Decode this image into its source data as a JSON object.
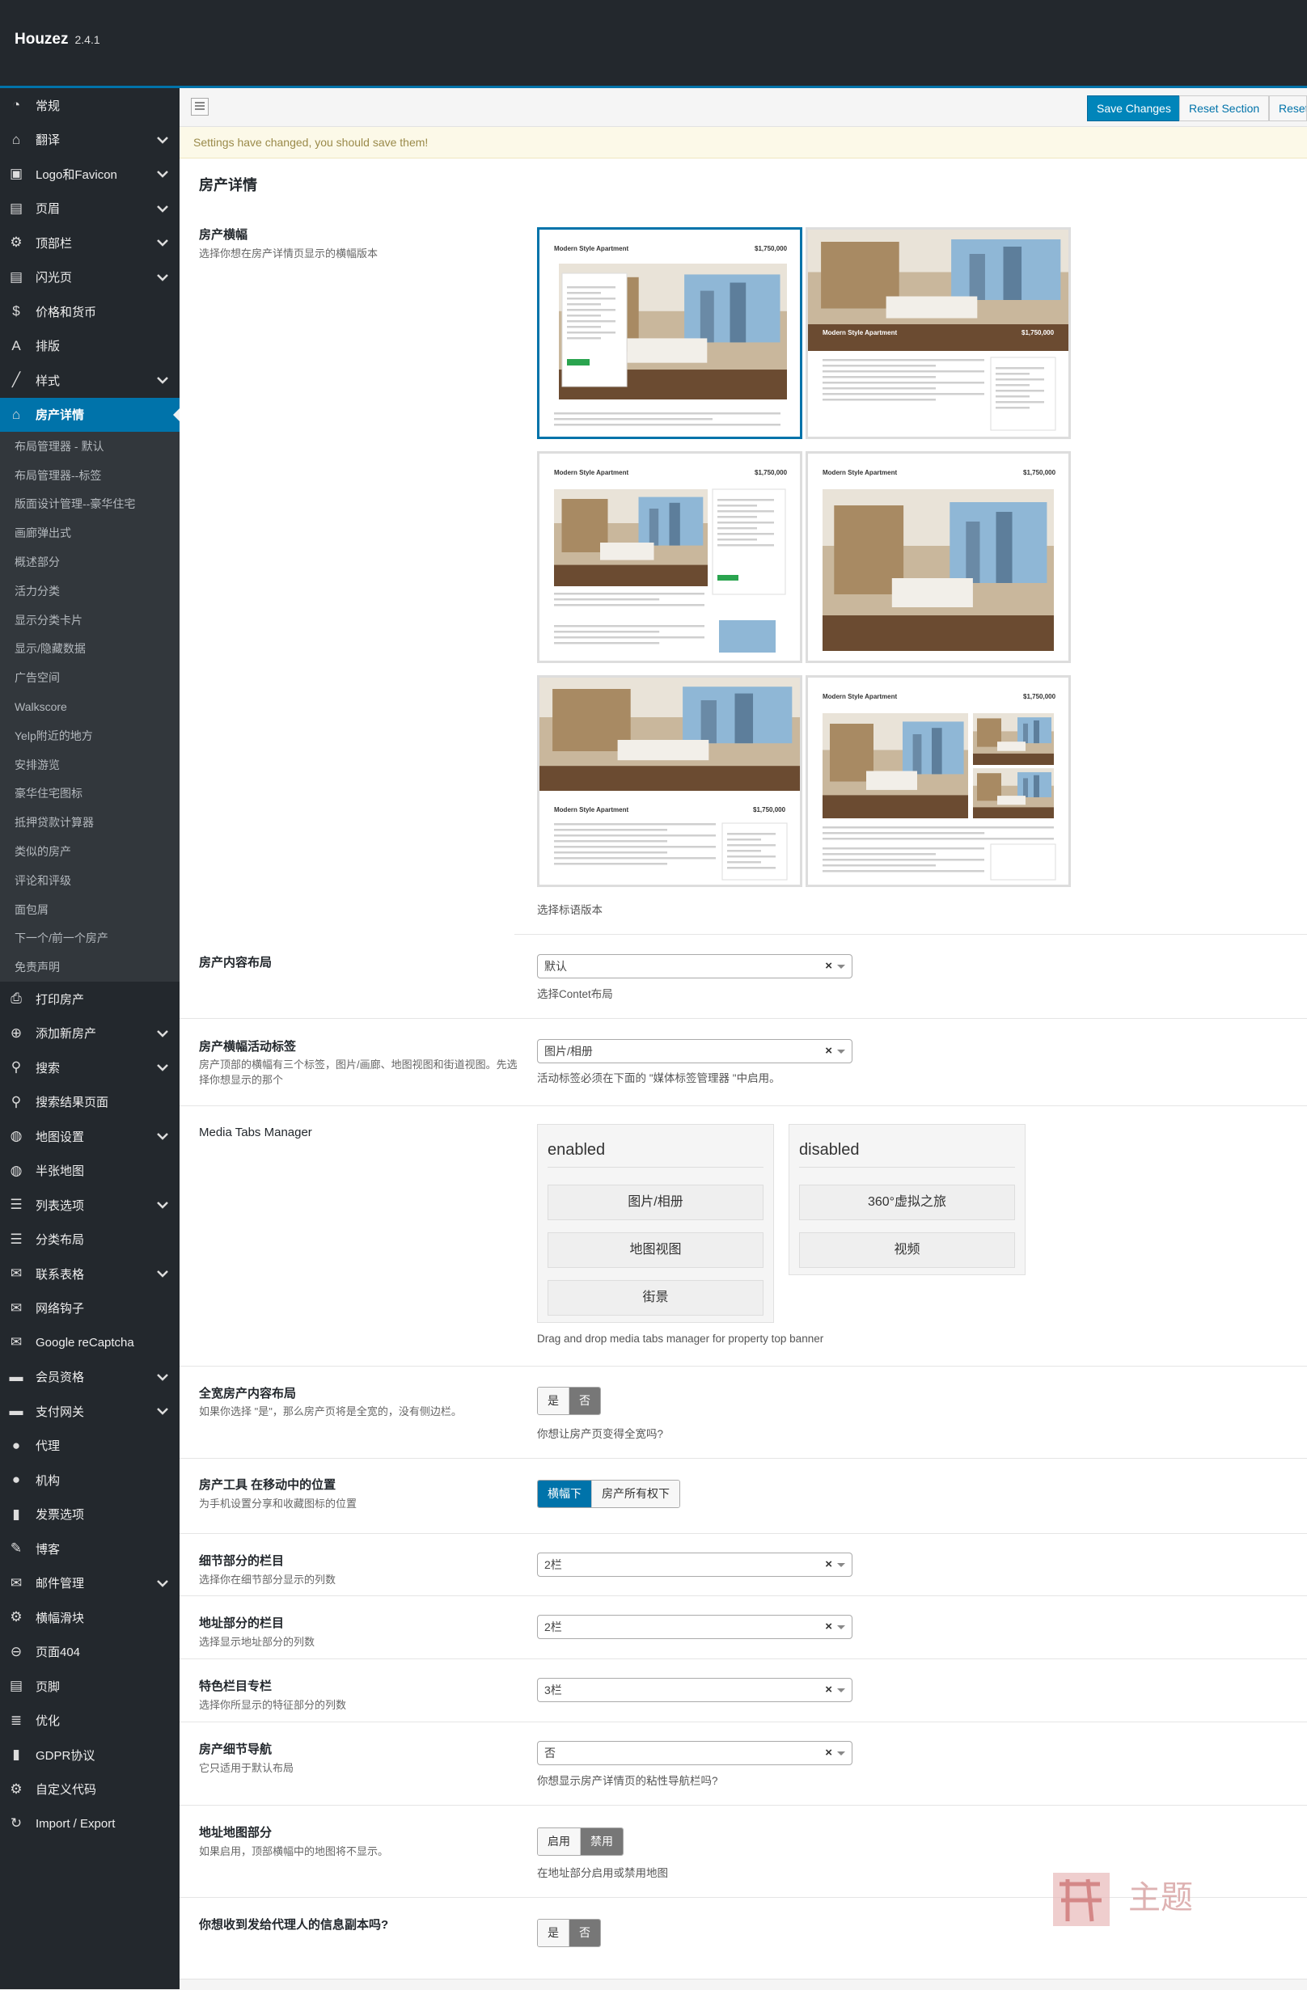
{
  "app": {
    "name": "Houzez",
    "version": "2.4.1"
  },
  "sidebar": {
    "items_top": [
      {
        "label": "常规",
        "icon": "gauge-icon",
        "arrow": false
      },
      {
        "label": "翻译",
        "icon": "home-icon",
        "arrow": true
      },
      {
        "label": "Logo和Favicon",
        "icon": "image-icon",
        "arrow": true
      },
      {
        "label": "页眉",
        "icon": "layout-icon",
        "arrow": true
      },
      {
        "label": "顶部栏",
        "icon": "gear-icon",
        "arrow": true
      },
      {
        "label": "闪光页",
        "icon": "layout-icon",
        "arrow": true
      },
      {
        "label": "价格和货币",
        "icon": "dollar-icon",
        "arrow": false
      },
      {
        "label": "排版",
        "icon": "font-icon",
        "arrow": false
      },
      {
        "label": "样式",
        "icon": "brush-icon",
        "arrow": true
      },
      {
        "label": "房产详情",
        "icon": "home-icon",
        "arrow": false,
        "active": true
      }
    ],
    "sub_items": [
      "布局管理器 - 默认",
      "布局管理器--标签",
      "版面设计管理--豪华住宅",
      "画廊弹出式",
      "概述部分",
      "活力分类",
      "显示分类卡片",
      "显示/隐藏数据",
      "广告空间",
      "Walkscore",
      "Yelp附近的地方",
      "安排游览",
      "豪华住宅图标",
      "抵押贷款计算器",
      "类似的房产",
      "评论和评级",
      "面包屑",
      "下一个/前一个房产",
      "免责声明"
    ],
    "items_bottom": [
      {
        "label": "打印房产",
        "icon": "print-icon",
        "arrow": false
      },
      {
        "label": "添加新房产",
        "icon": "plus-circle-icon",
        "arrow": true
      },
      {
        "label": "搜索",
        "icon": "search-icon",
        "arrow": true
      },
      {
        "label": "搜索结果页面",
        "icon": "search-icon",
        "arrow": false
      },
      {
        "label": "地图设置",
        "icon": "globe-icon",
        "arrow": true
      },
      {
        "label": "半张地图",
        "icon": "globe-icon",
        "arrow": false
      },
      {
        "label": "列表选项",
        "icon": "list-icon",
        "arrow": true
      },
      {
        "label": "分类布局",
        "icon": "list-icon",
        "arrow": false
      },
      {
        "label": "联系表格",
        "icon": "envelope-icon",
        "arrow": true
      },
      {
        "label": "网络钩子",
        "icon": "envelope-icon",
        "arrow": false
      },
      {
        "label": "Google reCaptcha",
        "icon": "envelope-icon",
        "arrow": false
      },
      {
        "label": "会员资格",
        "icon": "card-icon",
        "arrow": true
      },
      {
        "label": "支付网关",
        "icon": "card-icon",
        "arrow": true
      },
      {
        "label": "代理",
        "icon": "user-icon",
        "arrow": false
      },
      {
        "label": "机构",
        "icon": "user-icon",
        "arrow": false
      },
      {
        "label": "发票选项",
        "icon": "building-icon",
        "arrow": false
      },
      {
        "label": "博客",
        "icon": "edit-icon",
        "arrow": false
      },
      {
        "label": "邮件管理",
        "icon": "envelope-icon",
        "arrow": true
      },
      {
        "label": "横幅滑块",
        "icon": "gear-icon",
        "arrow": false
      },
      {
        "label": "页面404",
        "icon": "minus-circle-icon",
        "arrow": false
      },
      {
        "label": "页脚",
        "icon": "layout-icon",
        "arrow": false
      },
      {
        "label": "优化",
        "icon": "optimize-icon",
        "arrow": false
      },
      {
        "label": "GDPR协议",
        "icon": "bookmark-icon",
        "arrow": false
      },
      {
        "label": "自定义代码",
        "icon": "gear-icon",
        "arrow": false
      },
      {
        "label": "Import / Export",
        "icon": "refresh-icon",
        "arrow": false
      }
    ]
  },
  "toolbar": {
    "save": "Save Changes",
    "reset_section": "Reset Section",
    "reset": "Reset"
  },
  "notice": "Settings have changed, you should save them!",
  "section_title": "房产详情",
  "banner": {
    "title": "房产横幅",
    "desc": "选择你想在房产详情页显示的横幅版本",
    "note": "选择标语版本",
    "thumb_title": "Modern Style Apartment",
    "thumb_price": "$1,750,000",
    "selected_index": 0
  },
  "content_layout": {
    "title": "房产内容布局",
    "value": "默认",
    "note": "选择Contet布局"
  },
  "active_tab": {
    "title": "房产横幅活动标签",
    "desc": "房产顶部的横幅有三个标签，图片/画廊、地图视图和街道视图。先选择你想显示的那个",
    "value": "图片/相册",
    "note": "活动标签必须在下面的 \"媒体标签管理器 \"中启用。"
  },
  "media_tabs": {
    "title": "Media Tabs Manager",
    "enabled_label": "enabled",
    "disabled_label": "disabled",
    "enabled": [
      "图片/相册",
      "地图视图",
      "街景"
    ],
    "disabled": [
      "360°虚拟之旅",
      "视频"
    ],
    "note": "Drag and drop media tabs manager for property top banner"
  },
  "fullwidth": {
    "title": "全宽房产内容布局",
    "desc": "如果你选择 \"是\"，那么房产页将是全宽的，没有侧边栏。",
    "yes": "是",
    "no": "否",
    "note": "你想让房产页变得全宽吗?"
  },
  "tools_pos": {
    "title": "房产工具 在移动中的位置",
    "desc": "为手机设置分享和收藏图标的位置",
    "opt1": "横幅下",
    "opt2": "房产所有权下"
  },
  "detail_cols": {
    "title": "细节部分的栏目",
    "desc": "选择你在细节部分显示的列数",
    "value": "2栏"
  },
  "address_cols": {
    "title": "地址部分的栏目",
    "desc": "选择显示地址部分的列数",
    "value": "2栏"
  },
  "feature_cols": {
    "title": "特色栏目专栏",
    "desc": "选择你所显示的特征部分的列数",
    "value": "3栏"
  },
  "detail_nav": {
    "title": "房产细节导航",
    "desc": "它只适用于默认布局",
    "value": "否",
    "note": "你想显示房产详情页的粘性导航栏吗?"
  },
  "map_section": {
    "title": "地址地图部分",
    "desc": "如果启用，顶部横幅中的地图将不显示。",
    "on": "启用",
    "off": "禁用",
    "note": "在地址部分启用或禁用地图"
  },
  "agent_copy": {
    "title": "你想收到发给代理人的信息副本吗?",
    "yes": "是",
    "no": "否"
  },
  "clear_symbol": "×",
  "watermark_text": "主题",
  "colors": {
    "accent": "#0073aa",
    "sidebar": "#23282d",
    "notice": "#fcf9e8"
  }
}
